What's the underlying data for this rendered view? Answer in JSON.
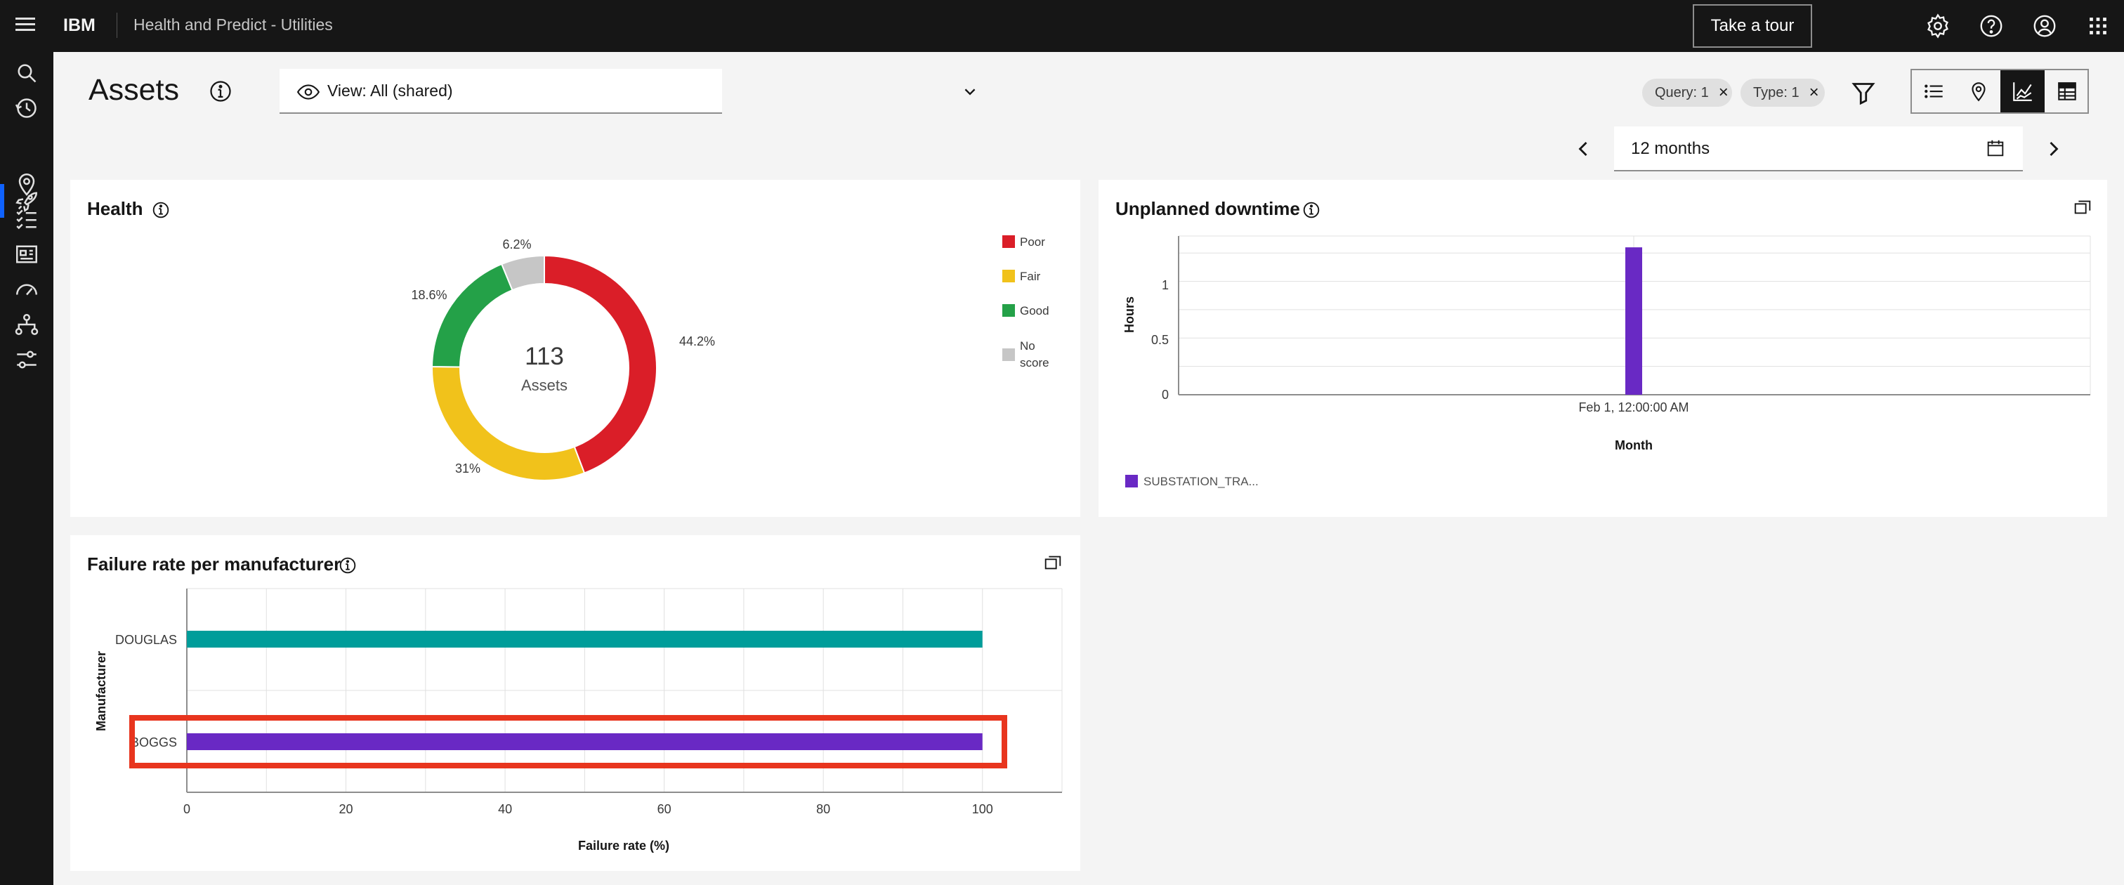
{
  "header": {
    "brand": "IBM",
    "product": "Health and Predict - Utilities",
    "tour_label": "Take a tour",
    "icons": [
      "settings-icon",
      "help-icon",
      "user-icon",
      "app-switcher-icon"
    ]
  },
  "rail": {
    "icons": [
      "search-icon",
      "history-icon",
      "rocket-icon",
      "location-icon",
      "checklist-icon",
      "dashboard-icon",
      "gauge-icon",
      "hierarchy-icon",
      "settings-sliders-icon"
    ]
  },
  "page": {
    "title": "Assets",
    "view_label": "View: All (shared)",
    "tags": [
      {
        "label": "Query: 1"
      },
      {
        "label": "Type: 1"
      }
    ],
    "date_range": "12 months"
  },
  "health": {
    "title": "Health",
    "center_value": "113",
    "center_label": "Assets",
    "colors": {
      "poor": "#da1e28",
      "fair": "#f1c21b",
      "good": "#24a148",
      "noscore": "#c6c6c6"
    },
    "legend": [
      "Poor",
      "Fair",
      "Good",
      "No",
      "score"
    ],
    "slice_labels": [
      "44.2%",
      "31%",
      "18.6%",
      "6.2%"
    ]
  },
  "downtime": {
    "title": "Unplanned downtime",
    "ylabel": "Hours",
    "xlabel": "Month",
    "yticks": [
      "0",
      "0.5",
      "1"
    ],
    "xtick": "Feb 1, 12:00:00 AM",
    "legend": "SUBSTATION_TRA..."
  },
  "failure": {
    "title": "Failure rate per manufacturer",
    "ylabel": "Manufacturer",
    "xlabel": "Failure rate (%)",
    "xticks": [
      "0",
      "20",
      "40",
      "60",
      "80",
      "100"
    ]
  },
  "chart_data": [
    {
      "type": "pie",
      "title": "Health",
      "categories": [
        "Poor",
        "Fair",
        "Good",
        "No score"
      ],
      "values": [
        44.2,
        31,
        18.6,
        6.2
      ],
      "colors": [
        "#da1e28",
        "#f1c21b",
        "#24a148",
        "#c6c6c6"
      ],
      "legend": "right"
    },
    {
      "type": "bar",
      "title": "Unplanned downtime",
      "categories": [
        "Feb 1, 12:00:00 AM"
      ],
      "series": [
        {
          "name": "SUBSTATION_TRA...",
          "values": [
            1.3
          ]
        }
      ],
      "xlabel": "Month",
      "ylabel": "Hours",
      "ylim": [
        0,
        1.4
      ],
      "grid": true,
      "color": "#6929c4"
    },
    {
      "type": "bar",
      "orientation": "horizontal",
      "title": "Failure rate per manufacturer",
      "categories": [
        "DOUGLAS",
        "BOGGS"
      ],
      "values": [
        100,
        100
      ],
      "colors": [
        "#009d9a",
        "#6929c4"
      ],
      "xlabel": "Failure rate (%)",
      "ylabel": "Manufacturer",
      "xlim": [
        0,
        110
      ],
      "grid": true,
      "highlight": "BOGGS",
      "highlight_color": "#e8351e"
    }
  ]
}
